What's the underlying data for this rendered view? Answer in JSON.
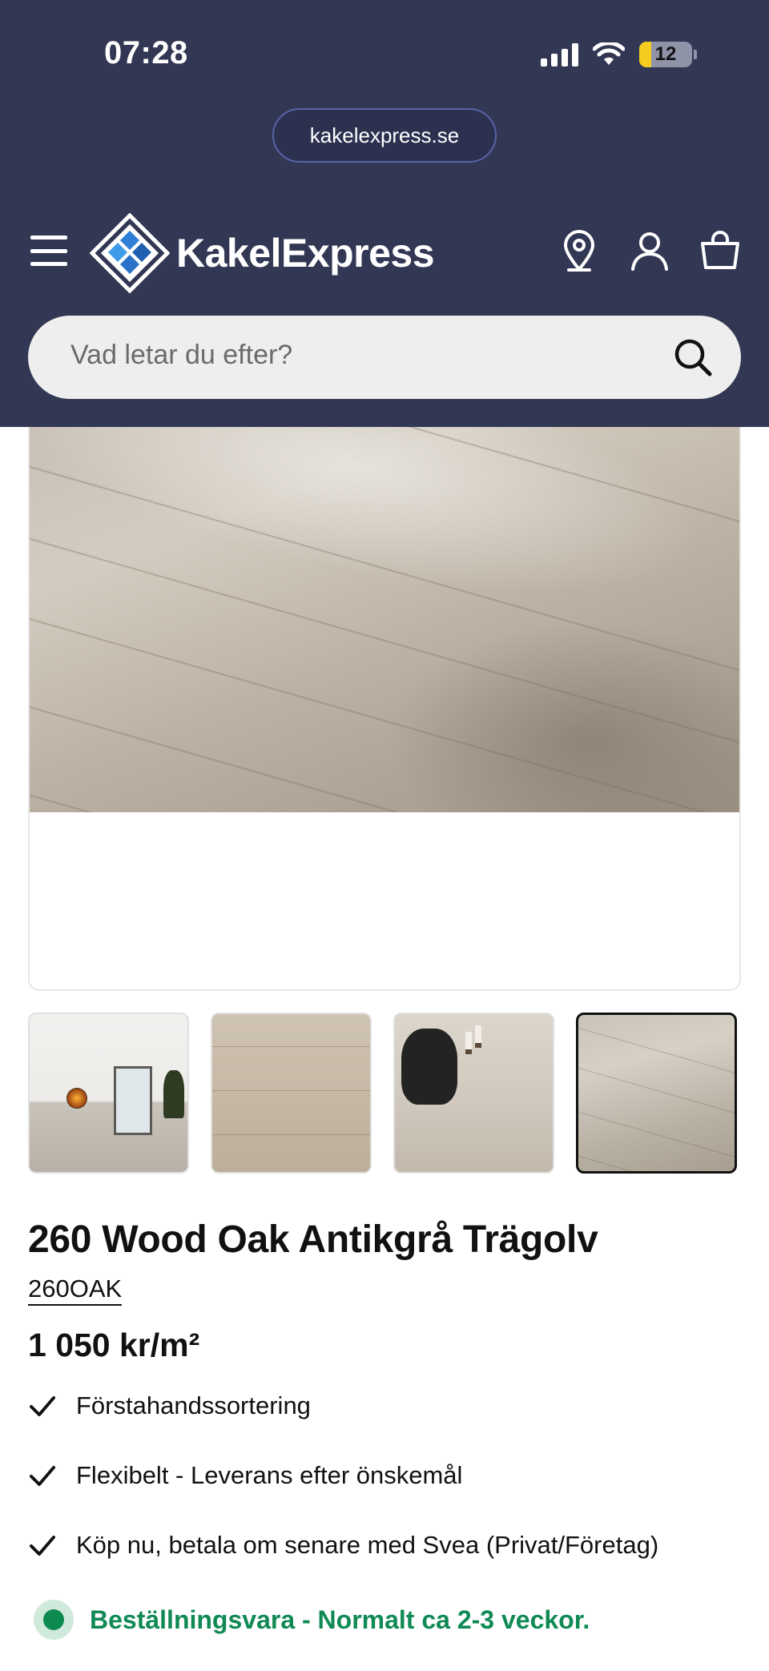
{
  "status_bar": {
    "time": "07:28",
    "battery": "12"
  },
  "browser": {
    "url": "kakelexpress.se"
  },
  "header": {
    "logo_text": "KakelExpress",
    "search_placeholder": "Vad letar du efter?"
  },
  "gallery": {
    "thumbnails": [
      "thumbnail-room",
      "thumbnail-floor-closeup",
      "thumbnail-person-on-floor",
      "thumbnail-floor-angle"
    ],
    "active_index": 3
  },
  "product": {
    "title": "260 Wood Oak Antikgrå Trägolv",
    "sku": "260OAK",
    "price": "1 050 kr/m²",
    "features": [
      "Förstahandssortering",
      "Flexibelt - Leverans efter önskemål",
      "Köp nu, betala om senare med Svea (Privat/Företag)"
    ],
    "stock_status": "Beställningsvara - Normalt ca 2-3 veckor."
  },
  "colors": {
    "header_bg": "#323754",
    "stock_green": "#108a55",
    "logo_blue": "#2f7fd6"
  }
}
